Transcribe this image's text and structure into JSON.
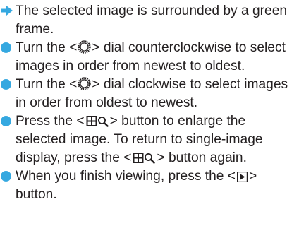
{
  "colors": {
    "bullet": "#35a8e0",
    "arrow": "#35a8e0",
    "text": "#231f20"
  },
  "items": [
    {
      "marker": "arrow-icon",
      "text": "The selected image is surrounded by a green frame."
    },
    {
      "marker": "bullet",
      "before": "Turn the <",
      "icon": "dial-icon",
      "after": "> dial counterclockwise to select images in order from newest to oldest."
    },
    {
      "marker": "bullet",
      "before": "Turn the <",
      "icon": "dial-icon",
      "after": "> dial clockwise to select images in order from oldest to newest."
    },
    {
      "marker": "bullet",
      "before": "Press the <",
      "icon": "index-magnify-icon",
      "middle": "> button to enlarge the selected image. To return to single-image display, press the <",
      "icon2": "index-magnify-icon",
      "after": "> button again."
    },
    {
      "marker": "bullet",
      "before": "When you finish viewing, press the <",
      "icon": "playback-icon",
      "after": "> button."
    }
  ]
}
